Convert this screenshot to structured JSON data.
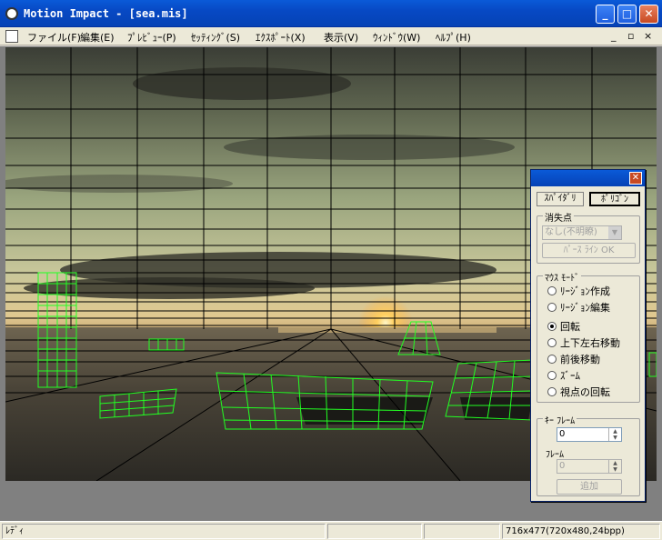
{
  "window": {
    "title": "Motion Impact - [sea.mis]",
    "minimize_glyph": "_",
    "maximize_glyph": "□",
    "close_glyph": "✕",
    "app_icon": "app-logo-icon"
  },
  "menubar": {
    "items": [
      {
        "label": "ファイル(F)"
      },
      {
        "label": "編集(E)"
      },
      {
        "label": "ﾌﾟﾚﾋﾞｭｰ(P)"
      },
      {
        "label": "ｾｯﾃｨﾝｸﾞ(S)"
      },
      {
        "label": "ｴｸｽﾎﾟｰﾄ(X)"
      },
      {
        "label": "表示(V)"
      },
      {
        "label": "ｳｨﾝﾄﾞｳ(W)"
      },
      {
        "label": "ﾍﾙﾌﾟ(H)"
      }
    ],
    "mdi_min": "_",
    "mdi_restore": "▫",
    "mdi_close": "×"
  },
  "statusbar": {
    "ready": "ﾚﾃﾞｨ",
    "info": "716x477(720x480,24bpp)"
  },
  "panel": {
    "close_glyph": "✕",
    "tabs": [
      {
        "label": "ｽﾊﾟｲﾀﾞﾘ"
      },
      {
        "label": "ﾎﾟﾘｺﾞﾝ"
      }
    ],
    "vanishing": {
      "label": "消失点",
      "combo_value": "なし(不明瞭)",
      "combo_arrow": "▼",
      "perspective_btn": "ﾊﾟｰｽ ﾗｲﾝ OK"
    },
    "mouse_mode": {
      "label": "ﾏｳｽ ﾓｰﾄﾞ",
      "options": [
        {
          "label": "ﾘｰｼﾞｮﾝ作成"
        },
        {
          "label": "ﾘｰｼﾞｮﾝ編集"
        },
        {
          "label": "回転"
        },
        {
          "label": "上下左右移動"
        },
        {
          "label": "前後移動"
        },
        {
          "label": "ｽﾞｰﾑ"
        },
        {
          "label": "視点の回転"
        }
      ],
      "selected_index": 2
    },
    "keyframe": {
      "label": "ｷｰ ﾌﾚｰﾑ",
      "value": "0",
      "frame_label": "ﾌﾚｰﾑ",
      "frame_value": "0",
      "add_btn": "追加"
    }
  },
  "colors": {
    "titlebar": "#0a5ad8",
    "region_wireframe": "#22ff22",
    "grid_lines": "#000000"
  }
}
